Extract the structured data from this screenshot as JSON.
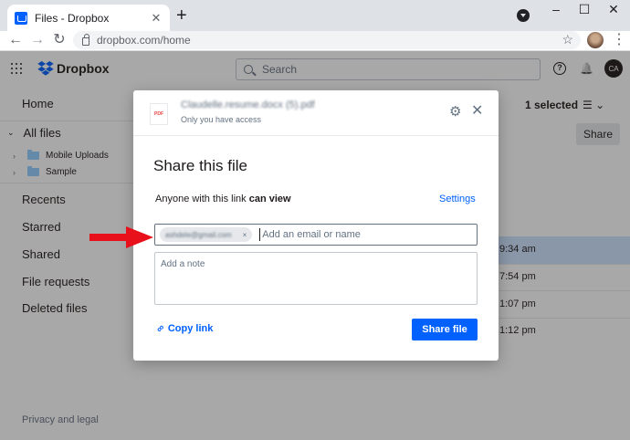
{
  "browser": {
    "tab_title": "Files - Dropbox",
    "tab_close": "✕",
    "new_tab": "+",
    "window_minimize": "–",
    "window_maximize": "☐",
    "window_close": "✕",
    "url": "dropbox.com/home",
    "back": "←",
    "forward": "→",
    "reload": "↻",
    "bookmark": "☆",
    "menu": "⋮"
  },
  "app": {
    "brand": "Dropbox",
    "search_placeholder": "Search",
    "help_icon": "?",
    "bell_icon": "🔔",
    "user_initials": "CA",
    "sidebar": {
      "home": "Home",
      "all_files": "All files",
      "tree": [
        "Mobile Uploads",
        "Sample"
      ],
      "links": [
        "Recents",
        "Starred",
        "Shared",
        "File requests",
        "Deleted files"
      ],
      "privacy": "Privacy and legal"
    },
    "main": {
      "selected_label": "1 selected",
      "share_button": "Share",
      "times": [
        "9:34 am",
        "7:54 pm",
        "1:07 pm",
        "1:12 pm"
      ]
    }
  },
  "modal": {
    "filename": "Claudelle.resume.docx (5).pdf",
    "thumb_label": "PDF",
    "access": "Only you have access",
    "title": "Share this file",
    "link_permission_prefix": "Anyone with this link",
    "link_permission_value": "can view",
    "settings_link": "Settings",
    "email_chip": "ashdele@gmail.com",
    "chip_remove": "×",
    "email_placeholder": "Add an email or name",
    "note_placeholder": "Add a note",
    "copy_link": "Copy link",
    "share_file": "Share file"
  },
  "colors": {
    "accent": "#0061fe",
    "arrow": "#e8101a"
  }
}
